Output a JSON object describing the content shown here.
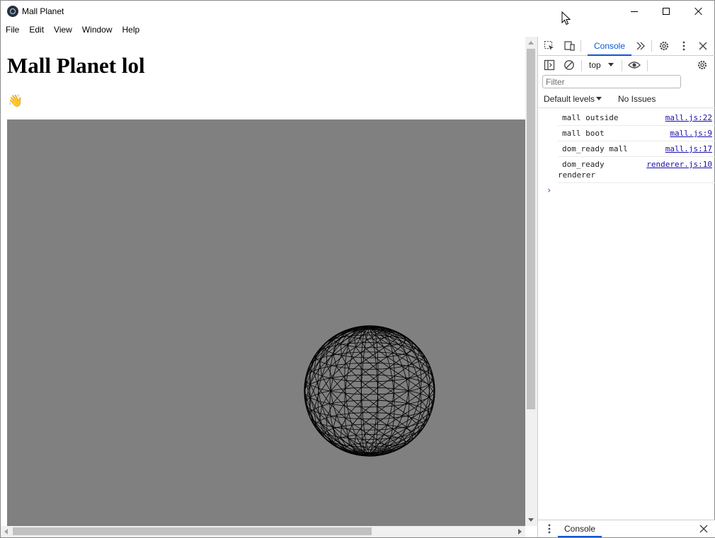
{
  "window": {
    "title": "Mall Planet",
    "icon": "electron-atom-icon"
  },
  "menu": [
    "File",
    "Edit",
    "View",
    "Window",
    "Help"
  ],
  "page": {
    "heading": "Mall Planet lol",
    "emoji": "👋",
    "canvas": {
      "background": "#808080",
      "object": "wireframe-sphere",
      "wire_color": "#000000"
    }
  },
  "devtools": {
    "active_tab": "Console",
    "context": "top",
    "filter_placeholder": "Filter",
    "levels": "Default levels",
    "issues": "No Issues",
    "logs": [
      {
        "message": "mall outside",
        "source": "mall.js:22"
      },
      {
        "message": "mall boot",
        "source": "mall.js:9"
      },
      {
        "message": "dom_ready mall",
        "source": "mall.js:17"
      },
      {
        "message": "dom_ready",
        "message_cont": "renderer",
        "source": "renderer.js:10"
      }
    ],
    "prompt": "›",
    "drawer_tab": "Console"
  }
}
